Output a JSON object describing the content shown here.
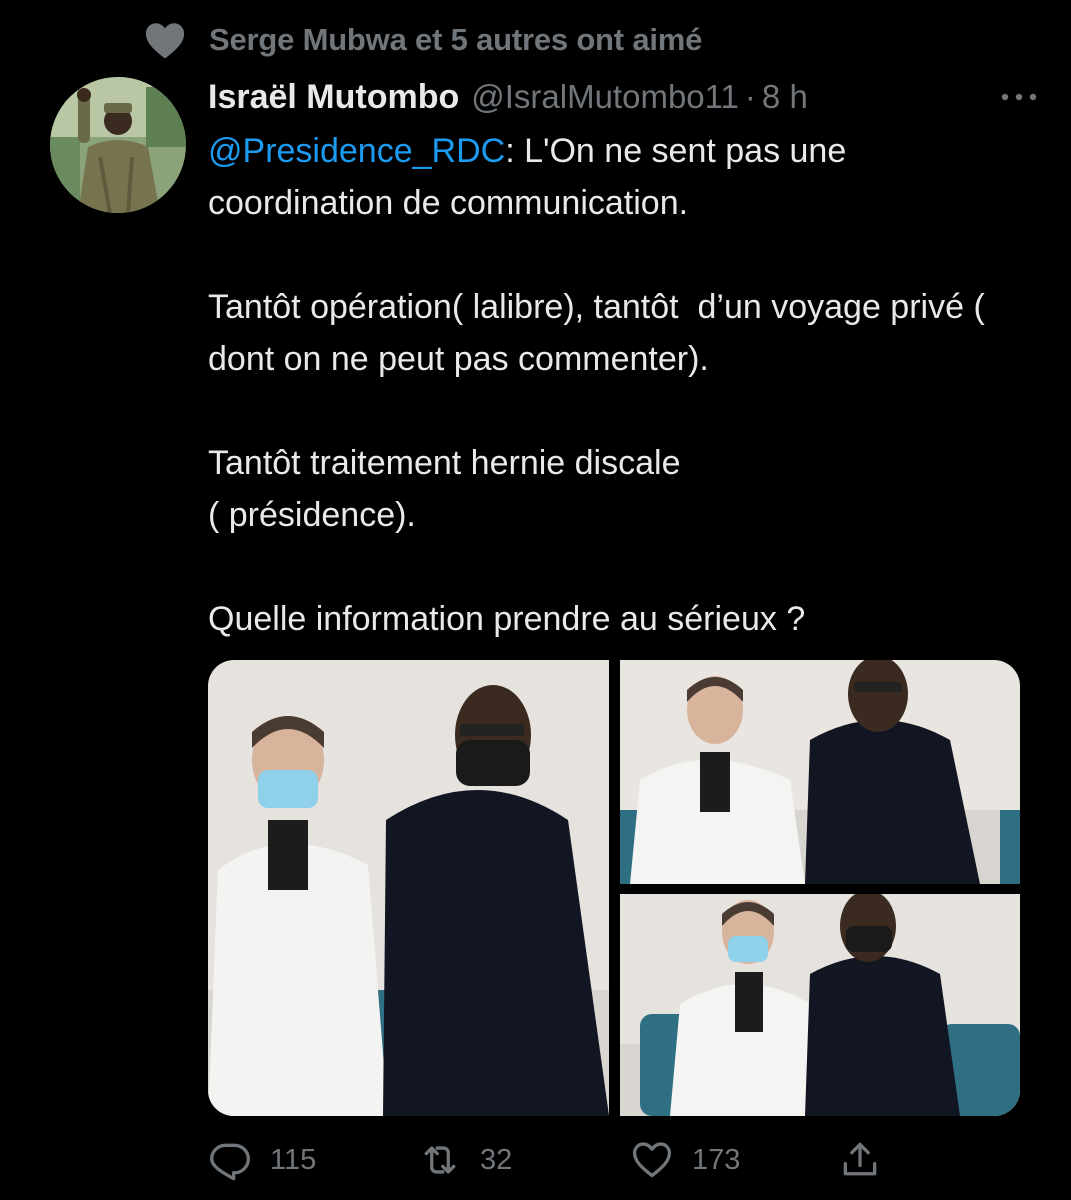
{
  "social_context": {
    "icon": "heart-filled-icon",
    "text": "Serge Mubwa et 5 autres ont aimé"
  },
  "tweet": {
    "author": {
      "display_name": "Israël Mutombo",
      "handle": "@IsralMutombo11",
      "avatar_icon": "avatar"
    },
    "separator": "·",
    "time": "8 h",
    "more_icon": "more-horizontal-icon",
    "body": {
      "mention": "@Presidence_RDC",
      "line1_rest": ": L'On ne sent pas une coordination de communication.",
      "paragraph2": "Tantôt opération( lalibre), tantôt  d’un voyage privé ( dont on ne peut pas commenter).",
      "paragraph3": "Tantôt traitement hernie discale\n( présidence).",
      "paragraph4": "Quelle information prendre au sérieux ?"
    },
    "media_count": 3,
    "actions": {
      "reply": {
        "icon": "reply-icon",
        "count": "115"
      },
      "retweet": {
        "icon": "retweet-icon",
        "count": "32"
      },
      "like": {
        "icon": "heart-outline-icon",
        "count": "173"
      },
      "share": {
        "icon": "share-icon"
      }
    }
  },
  "colors": {
    "background": "#000000",
    "text_primary": "#e7e9ea",
    "text_secondary": "#71767b",
    "link": "#1d9bf0"
  }
}
